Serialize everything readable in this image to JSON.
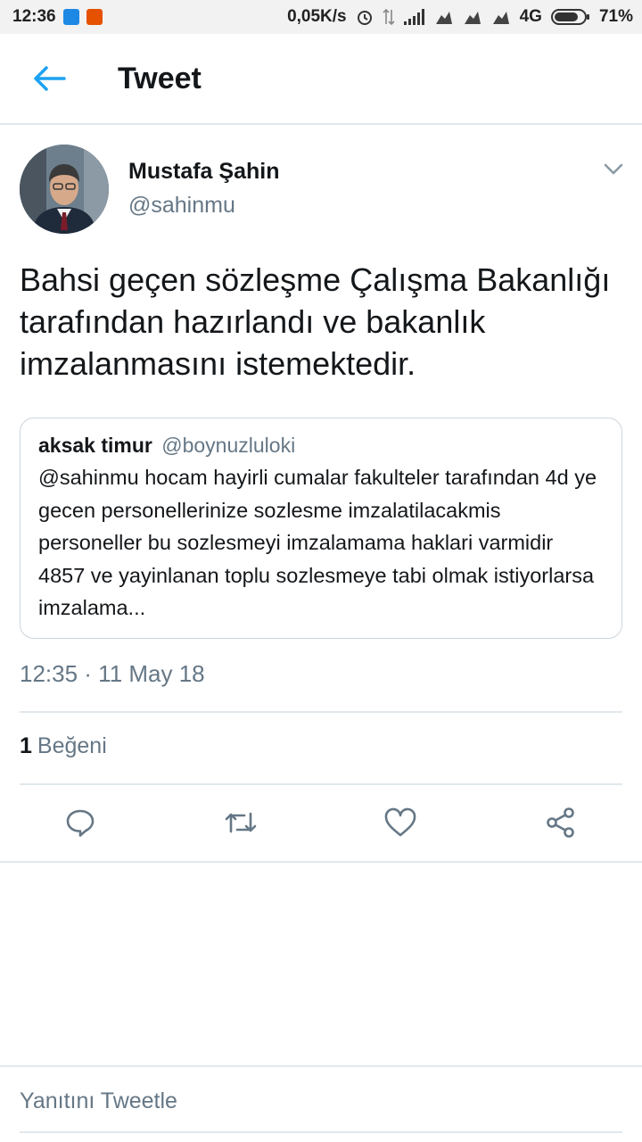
{
  "status_bar": {
    "time": "12:36",
    "network_speed": "0,05K/s",
    "network_type": "4G",
    "battery": "71%"
  },
  "app_bar": {
    "title": "Tweet"
  },
  "tweet": {
    "author_name": "Mustafa Şahin",
    "author_handle": "@sahinmu",
    "text": "Bahsi geçen sözleşme Çalışma Bakanlığı tarafından hazırlandı ve bakanlık imzalanmasını istemektedir.",
    "timestamp": "12:35 · 11 May 18",
    "like_count": "1",
    "like_label": "Beğeni"
  },
  "quoted_tweet": {
    "author_name": "aksak timur",
    "author_handle": "@boynuzluloki",
    "text": "@sahinmu hocam hayirli cumalar fakulteler tarafından 4d ye gecen personellerinize sozlesme imzalatilacakmis personeller bu sozlesmeyi imzalamama haklari varmidir 4857 ve yayinlanan toplu sozlesmeye tabi olmak istiyorlarsa imzalama..."
  },
  "reply": {
    "placeholder": "Yanıtını Tweetle"
  },
  "colors": {
    "accent": "#1da1f2",
    "secondary_text": "#657786",
    "border": "#e1e8ed"
  },
  "icons": [
    "back-arrow-icon",
    "chevron-down-icon",
    "reply-icon",
    "retweet-icon",
    "like-icon",
    "share-icon"
  ]
}
